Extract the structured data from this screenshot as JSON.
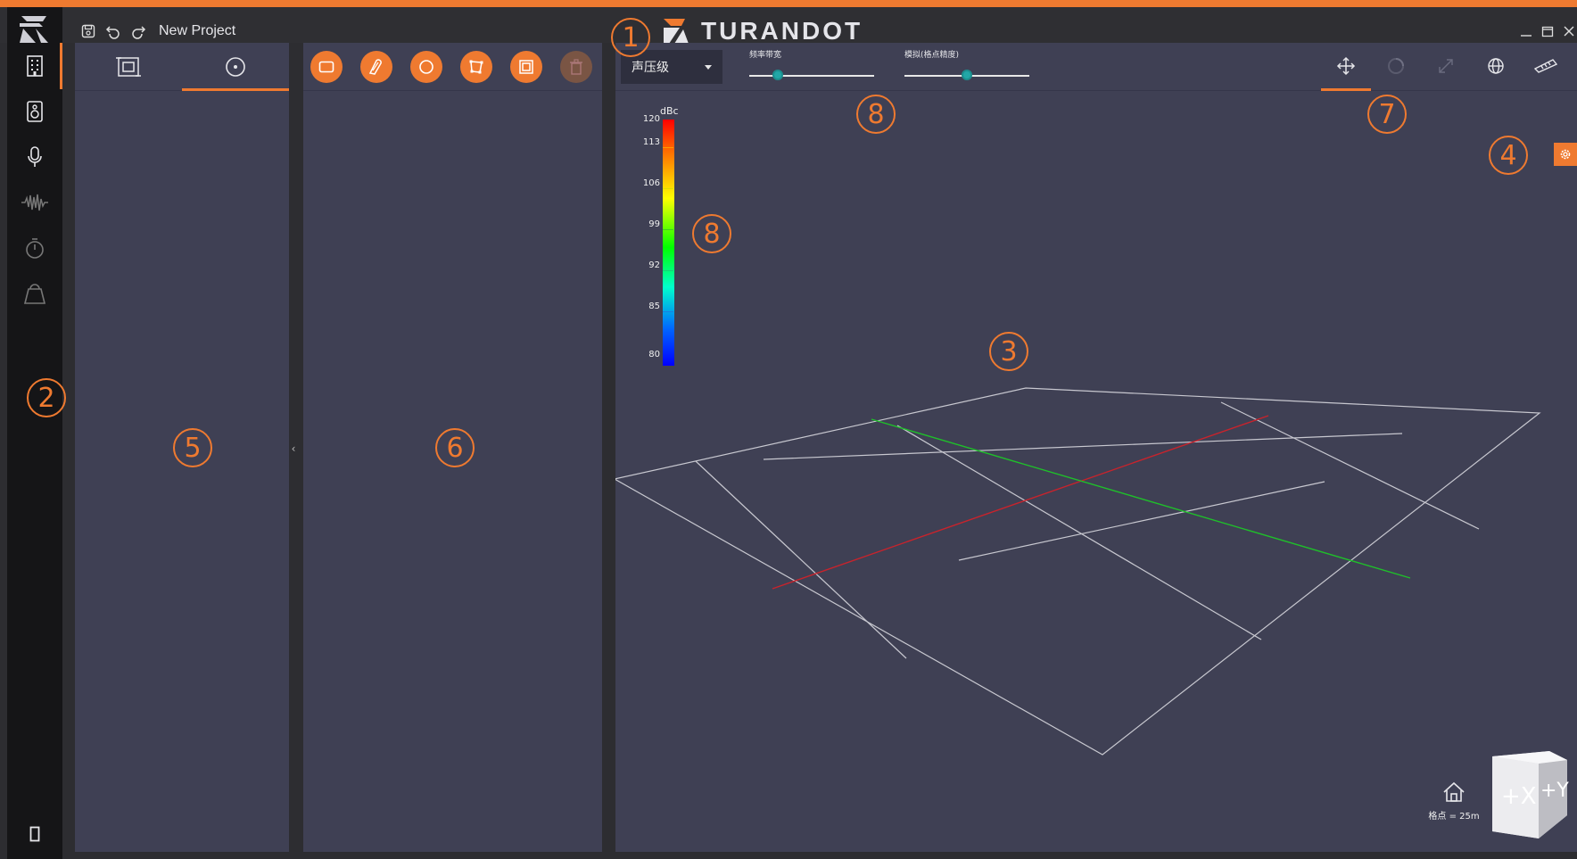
{
  "titlebar": {
    "project_name": "New Project",
    "brand_name": "TURANDOT"
  },
  "sidebar": {
    "items": [
      {
        "name": "building",
        "icon": "building-icon",
        "active": true
      },
      {
        "name": "speaker",
        "icon": "speaker-icon",
        "active": false
      },
      {
        "name": "microphone",
        "icon": "microphone-icon",
        "active": false
      },
      {
        "name": "waveform",
        "icon": "waveform-icon",
        "active": false
      },
      {
        "name": "timer",
        "icon": "stopwatch-icon",
        "active": false
      },
      {
        "name": "weight",
        "icon": "weight-icon",
        "active": false
      }
    ]
  },
  "panel5": {
    "tabs": [
      {
        "icon": "model-frame-icon",
        "active": false
      },
      {
        "icon": "target-circle-icon",
        "active": true
      }
    ]
  },
  "panel6": {
    "tools": [
      {
        "icon": "rectangle-icon",
        "enabled": true
      },
      {
        "icon": "brush-icon",
        "enabled": true
      },
      {
        "icon": "circle-icon",
        "enabled": true
      },
      {
        "icon": "polygon-icon",
        "enabled": true
      },
      {
        "icon": "frame-select-icon",
        "enabled": true
      },
      {
        "icon": "trash-icon",
        "enabled": false
      }
    ]
  },
  "viewport": {
    "metric_select": "声压级",
    "slider1": {
      "label": "频率带宽",
      "value": 0.23
    },
    "slider2": {
      "label": "模拟(格点精度)",
      "value": 0.5
    },
    "legend": {
      "unit": "dBc",
      "ticks": [
        "120",
        "113",
        "106",
        "99",
        "92",
        "85",
        "80"
      ]
    },
    "grid_label": "格点 = 25m",
    "cube_labels": {
      "x": "+X",
      "y": "+Y"
    }
  },
  "callouts": [
    "1",
    "2",
    "3",
    "4",
    "5",
    "6",
    "7",
    "8",
    "8"
  ],
  "colors": {
    "accent": "#ef7a30",
    "panel": "#3f4054",
    "axis_red": "#c8232c",
    "axis_green": "#1fbf2a"
  }
}
